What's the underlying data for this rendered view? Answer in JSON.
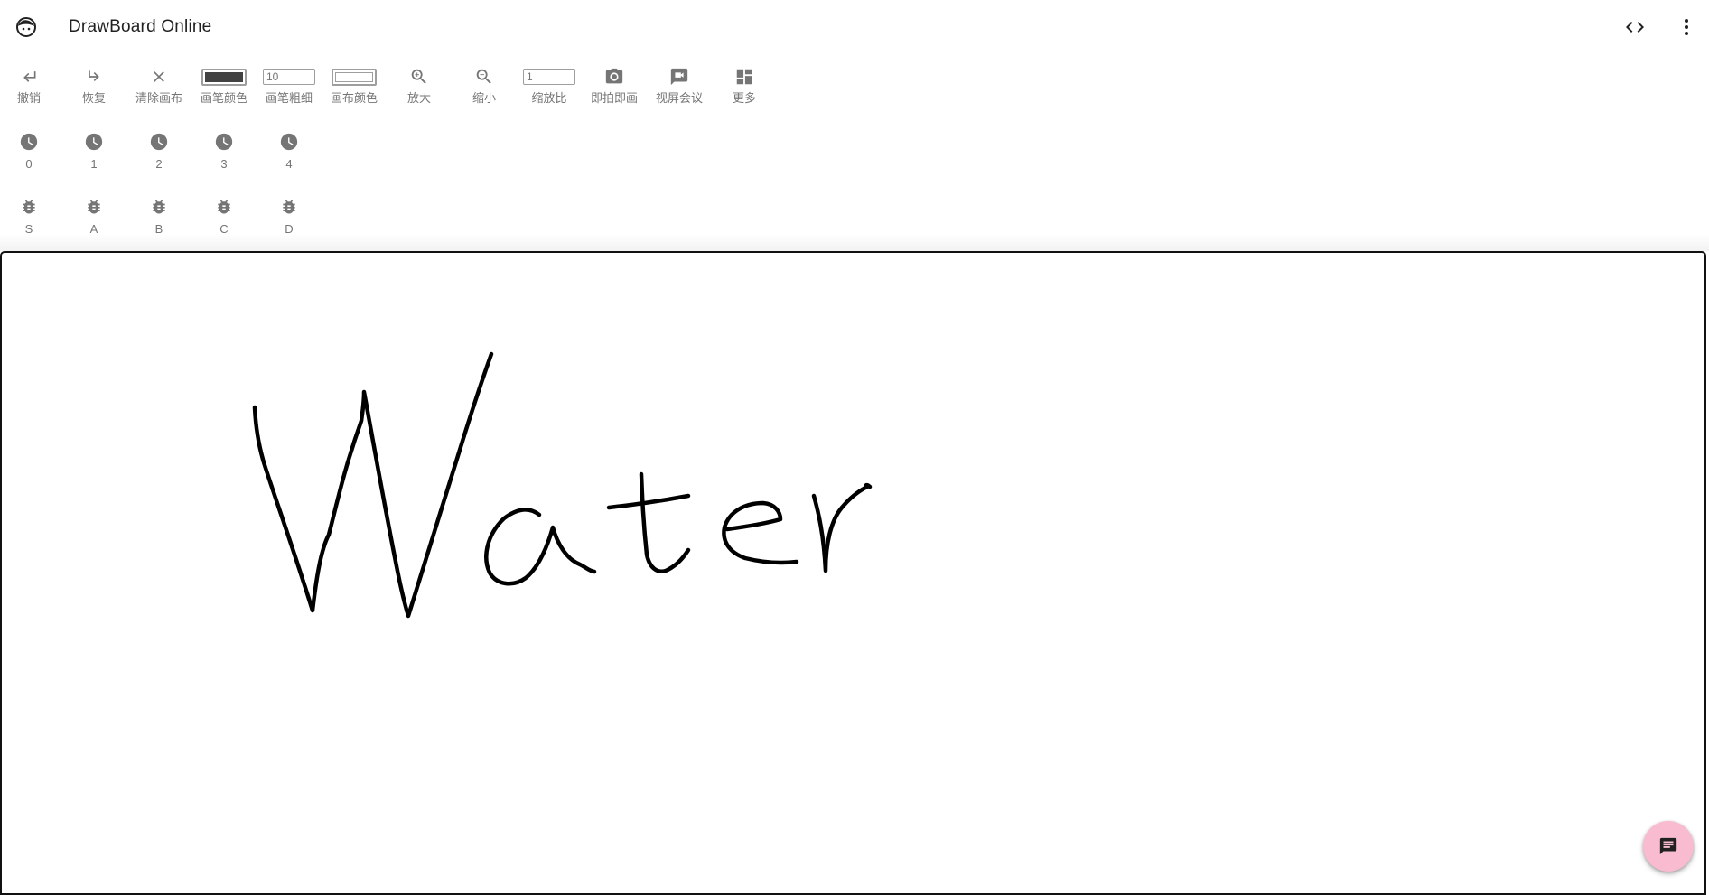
{
  "app": {
    "title": "DrawBoard Online"
  },
  "appbar": {
    "code_icon": "code-icon",
    "more_icon": "more-vert-icon"
  },
  "toolbar": {
    "undo": "撤销",
    "redo": "恢复",
    "clear": "清除画布",
    "pen_color": "画笔颜色",
    "pen_width": "画笔粗细",
    "pen_width_value": "10",
    "canvas_color": "画布颜色",
    "zoom_in": "放大",
    "zoom_out": "缩小",
    "zoom_ratio": "缩放比",
    "zoom_ratio_value": "1",
    "snapshot": "即拍即画",
    "video_meeting": "视屏会议",
    "more": "更多"
  },
  "history": {
    "icon": "clock-icon",
    "items": [
      "0",
      "1",
      "2",
      "3",
      "4"
    ]
  },
  "debug": {
    "icon": "bug-icon",
    "items": [
      "S",
      "A",
      "B",
      "C",
      "D"
    ]
  },
  "colors": {
    "pen": "#424242",
    "canvas": "#ffffff",
    "fab": "#f8bbd0",
    "icon": "#757575"
  },
  "canvas": {
    "drawing_text": "Water"
  },
  "fab": {
    "icon": "chat-icon"
  }
}
